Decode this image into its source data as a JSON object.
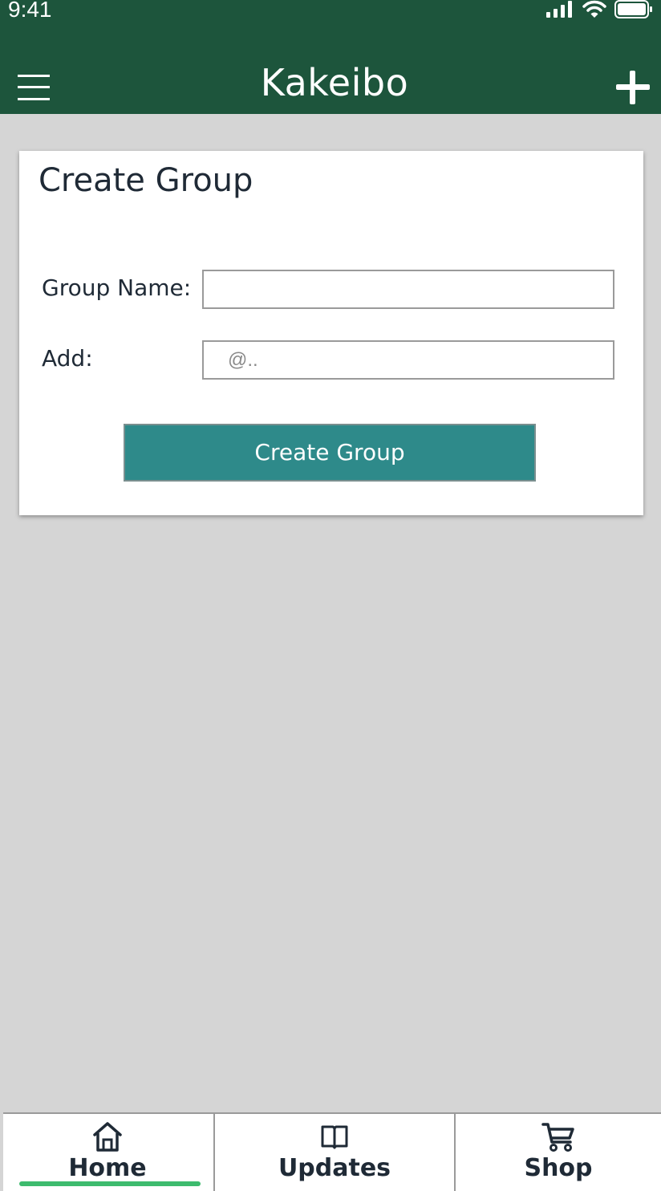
{
  "status_bar": {
    "time": "9:41",
    "icons": [
      "cellular-signal-icon",
      "wifi-icon",
      "battery-icon"
    ]
  },
  "header": {
    "title": "Kakeibo",
    "left_icon": "hamburger-menu-icon",
    "right_icon": "plus-icon"
  },
  "card": {
    "title": "Create Group",
    "group_name_label": "Group Name:",
    "group_name_value": "",
    "add_label": "Add:",
    "add_placeholder": "@..",
    "submit_label": "Create Group"
  },
  "tabs": [
    {
      "label": "Home",
      "icon": "home-icon",
      "active": true
    },
    {
      "label": "Updates",
      "icon": "book-icon",
      "active": false
    },
    {
      "label": "Shop",
      "icon": "shopping-cart-icon",
      "active": false
    }
  ],
  "colors": {
    "header_bg": "#1d553c",
    "page_bg": "#d5d5d5",
    "button_bg": "#2e8a8a",
    "active_tab_indicator": "#3dbb6e",
    "text": "#1f2a36"
  }
}
